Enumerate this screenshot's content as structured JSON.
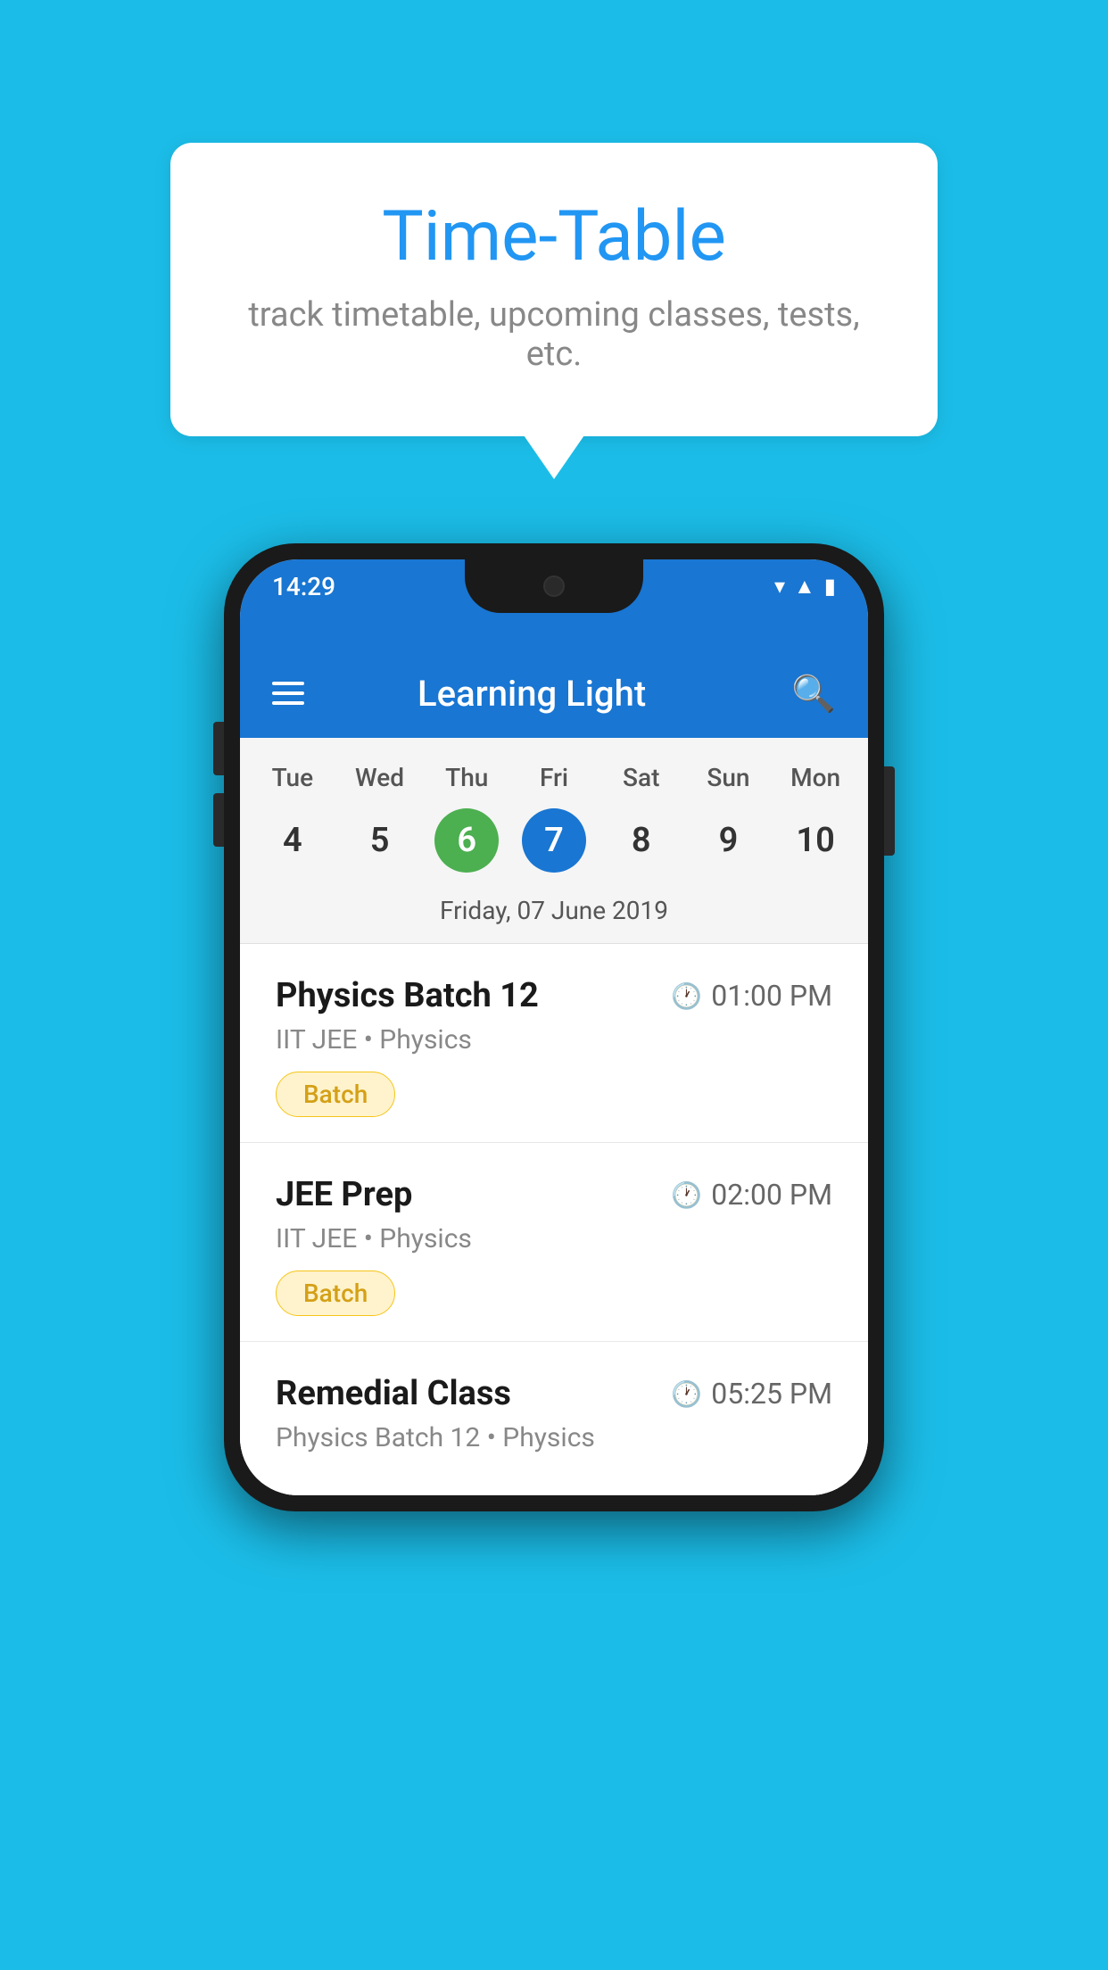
{
  "background_color": "#1BBDE8",
  "tooltip": {
    "title": "Time-Table",
    "subtitle": "track timetable, upcoming classes, tests, etc."
  },
  "phone": {
    "status_bar": {
      "time": "14:29"
    },
    "app_bar": {
      "title": "Learning Light"
    },
    "calendar": {
      "days": [
        "Tue",
        "Wed",
        "Thu",
        "Fri",
        "Sat",
        "Sun",
        "Mon"
      ],
      "dates": [
        "4",
        "5",
        "6",
        "7",
        "8",
        "9",
        "10"
      ],
      "today_index": 2,
      "selected_index": 3,
      "selected_date_label": "Friday, 07 June 2019"
    },
    "classes": [
      {
        "name": "Physics Batch 12",
        "time": "01:00 PM",
        "detail": "IIT JEE • Physics",
        "badge": "Batch"
      },
      {
        "name": "JEE Prep",
        "time": "02:00 PM",
        "detail": "IIT JEE • Physics",
        "badge": "Batch"
      },
      {
        "name": "Remedial Class",
        "time": "05:25 PM",
        "detail": "Physics Batch 12 • Physics",
        "badge": null
      }
    ]
  }
}
